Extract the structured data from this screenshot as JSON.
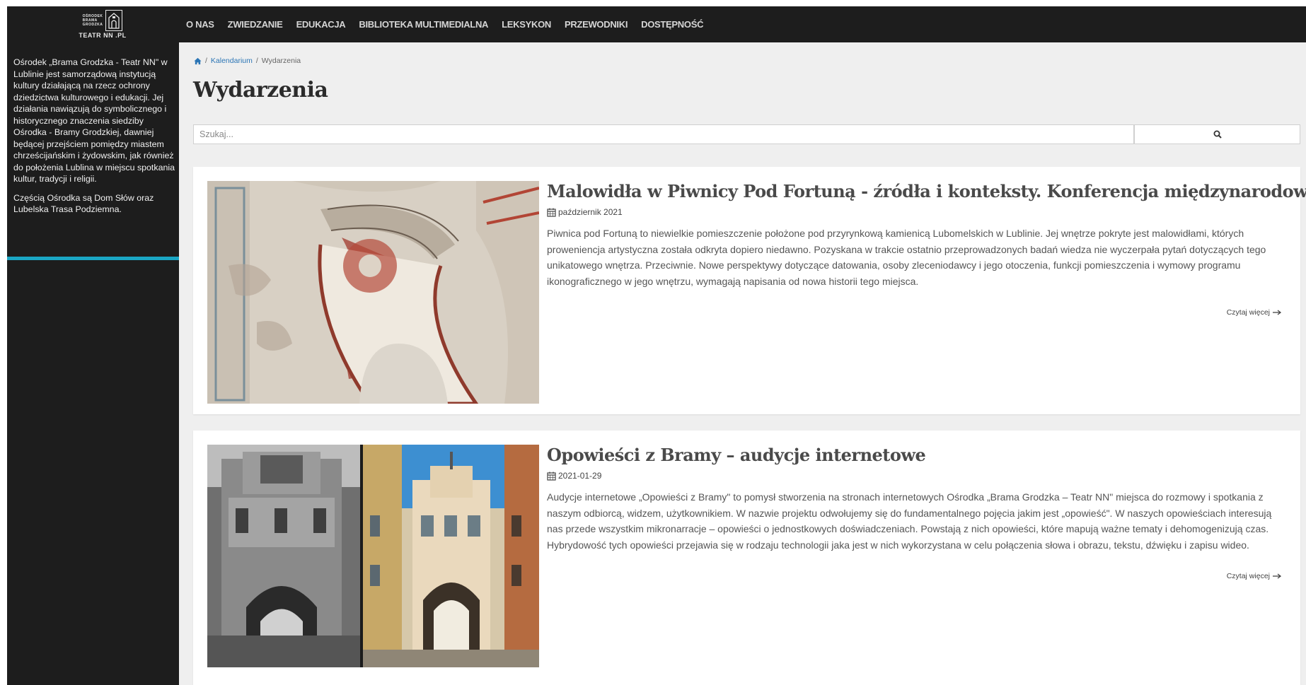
{
  "logo": {
    "lines": [
      "OŚRODEK",
      "BRAMA",
      "GRODZKA"
    ],
    "text": "TEATR NN .PL"
  },
  "nav": {
    "items": [
      "O NAS",
      "ZWIEDZANIE",
      "EDUKACJA",
      "BIBLIOTEKA MULTIMEDIALNA",
      "LEKSYKON",
      "PRZEWODNIKI",
      "DOSTĘPNOŚĆ"
    ]
  },
  "sidebar": {
    "paragraph1": "Ośrodek „Brama Grodzka - Teatr NN\" w Lublinie jest samorządową instytucją kultury działającą na rzecz ochrony dziedzictwa kulturowego i edukacji. Jej działania nawiązują do symbolicznego i historycznego znaczenia siedziby Ośrodka - Bramy Grodzkiej, dawniej będącej przejściem pomiędzy miastem chrześcijańskim i żydowskim, jak również do położenia Lublina w miejscu spotkania kultur, tradycji i religii.",
    "paragraph2": "Częścią Ośrodka są Dom Słów oraz Lubelska Trasa Podziemna.",
    "accent_color": "#1aa6c4"
  },
  "breadcrumb": {
    "separator": "/",
    "items": [
      "Kalendarium",
      "Wydarzenia"
    ]
  },
  "page": {
    "title": "Wydarzenia"
  },
  "search": {
    "placeholder": "Szukaj...",
    "value": ""
  },
  "events": [
    {
      "title": "Malowidła w Piwnicy Pod Fortuną - źródła i konteksty. Konferencja międzynarodowa",
      "date": "październik 2021",
      "text": "Piwnica pod Fortuną to niewielkie pomieszczenie położone pod przyrynkową kamienicą Lubomelskich w Lublinie. Jej wnętrze pokryte jest malowidłami, których proweniencja artystyczna została odkryta dopiero niedawno. Pozyskana w trakcie ostatnio przeprowadzonych badań wiedza nie wyczerpała pytań dotyczących tego unikatowego wnętrza. Przeciwnie. Nowe perspektywy dotyczące datowania, osoby zleceniodawcy i jego otoczenia, funkcji pomieszczenia i wymowy programu ikonograficznego w jego wnętrzu, wymagają napisania od nowa historii tego miejsca.",
      "read_more": "Czytaj więcej"
    },
    {
      "title": "Opowieści z Bramy – audycje internetowe",
      "date": "2021-01-29",
      "text": "Audycje internetowe „Opowieści z Bramy\" to pomysł stworzenia na stronach internetowych Ośrodka „Brama Grodzka – Teatr NN\" miejsca do rozmowy i spotkania z naszym odbiorcą, widzem, użytkownikiem. W nazwie projektu odwołujemy się do fundamentalnego pojęcia jakim jest „opowieść\". W naszych opowieściach interesują nas przede wszystkim mikronarracje – opowieści o jednostkowych doświadczeniach. Powstają z nich opowieści, które mapują ważne tematy i dehomogenizują czas. Hybrydowość tych opowieści przejawia się w rodzaju technologii jaka jest w nich wykorzystana w celu połączenia słowa i obrazu, tekstu, dźwięku i zapisu wideo.",
      "read_more": "Czytaj więcej"
    }
  ],
  "icons": {
    "home": "home-icon",
    "search": "search-icon",
    "calendar": "calendar-icon",
    "arrow": "arrow-right-icon"
  }
}
